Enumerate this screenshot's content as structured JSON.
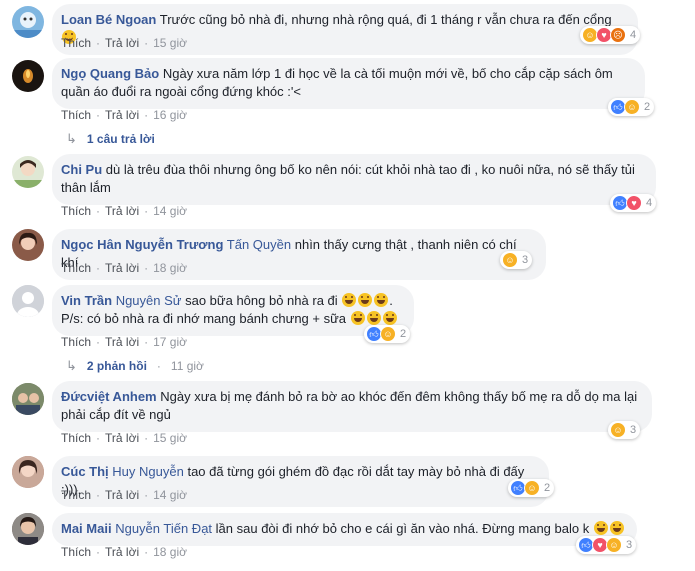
{
  "meta": {
    "like_label": "Thích",
    "reply_label": "Trả lời",
    "sep": "·"
  },
  "comments": [
    {
      "name": "Loan Bé Ngoan",
      "tagged": "",
      "text": "Trước cũng bỏ nhà đi, nhưng nhà rộng quá, đi 1 tháng r vẫn chưa ra đến cổng",
      "time": "15 giờ",
      "reactions": [
        "haha",
        "love",
        "angry"
      ],
      "count": "4",
      "avatar_color": "#7fb6e0"
    },
    {
      "name": "Ngọ Quang Bảo",
      "tagged": "",
      "text": "Ngày xưa năm lớp 1 đi học về la cà tối muộn mới về, bố cho cắp cặp sách ôm quần áo đuổi ra ngoài cổng đứng khóc :'<",
      "time": "16 giờ",
      "reactions": [
        "like",
        "haha"
      ],
      "count": "2",
      "avatar_color": "#3a2a1a"
    },
    {
      "name": "Chi Pu",
      "tagged": "",
      "text": "dù là trêu đùa thôi nhưng ông bố ko nên nói: cút khỏi nhà tao đi , ko nuôi nữa, nó sẽ thấy tủi thân lắm",
      "time": "14 giờ",
      "reactions": [
        "like",
        "love"
      ],
      "count": "4",
      "avatar_color": "#c9d8b8"
    },
    {
      "name": "Ngọc Hân Nguyễn Trương",
      "tagged": "Tấn Quyền",
      "text": "nhìn thấy cưng thật , thanh niên có chí khí",
      "time": "18 giờ",
      "reactions": [
        "haha"
      ],
      "count": "3",
      "avatar_color": "#8a5a48"
    },
    {
      "name": "Vin Trần",
      "tagged": "Nguyên Sử",
      "text": "sao bữa hông bỏ nhà ra đi",
      "text2": "P/s: có bỏ nhà ra đi nhớ mang bánh chưng + sữa",
      "time": "17 giờ",
      "reactions": [
        "like",
        "haha"
      ],
      "count": "2",
      "avatar_color": "#d0d3d9",
      "replies_label": "2 phản hồi",
      "replies_time": "11 giờ"
    },
    {
      "name": "Đứcviệt Anhem",
      "tagged": "",
      "text": "Ngày xưa bị mẹ đánh bỏ ra bờ ao khóc đến đêm không thấy bố mẹ ra dỗ dọ ma lại phải cắp đít về ngủ",
      "time": "15 giờ",
      "reactions": [
        "haha"
      ],
      "count": "3",
      "avatar_color": "#6e7d5c"
    },
    {
      "name": "Cúc Thị",
      "tagged": "Huy Nguyễn",
      "text": "tao đã từng gói ghém đồ đạc rồi dắt tay mày bỏ nhà đi đấy :))).",
      "time": "14 giờ",
      "reactions": [
        "like",
        "haha"
      ],
      "count": "2",
      "avatar_color": "#b07a6a"
    },
    {
      "name": "Mai Maii",
      "tagged": "Nguyễn Tiến Đạt",
      "text": "lần sau đòi đi nhớ bỏ cho e cái gì ăn vào nhá. Đừng mang balo k",
      "time": "18 giờ",
      "reactions": [
        "like",
        "love",
        "haha"
      ],
      "count": "3",
      "avatar_color": "#5a4a48"
    }
  ],
  "reply_threads": [
    {
      "label": "1 câu trả lời"
    }
  ],
  "icons": {
    "reply_arrow": "reply-arrow-icon"
  }
}
